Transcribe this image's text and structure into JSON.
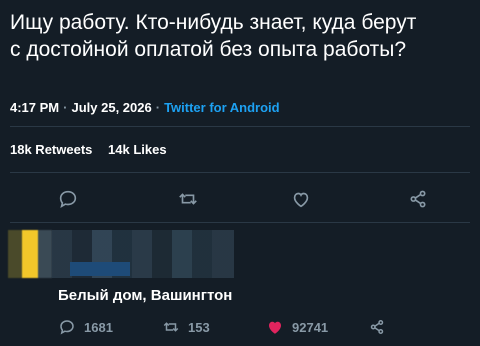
{
  "tweet": {
    "text_line1": "Ищу работу. Кто-нибудь знает, куда берут",
    "text_line2": "с достойной оплатой без опыта работы?",
    "time": "4:17 PM",
    "date": "July 25, 2026",
    "source": "Twitter for Android",
    "separator": "·"
  },
  "stats": {
    "retweets": "18k Retweets",
    "likes": "14k Likes"
  },
  "actions": [
    {
      "icon": "reply-icon"
    },
    {
      "icon": "retweet-icon"
    },
    {
      "icon": "like-icon"
    },
    {
      "icon": "share-icon"
    }
  ],
  "reply": {
    "location": "Белый дом, Вашингтон",
    "reply_count": "1681",
    "retweet_count": "153",
    "like_count": "92741",
    "like_color": "#e0245e"
  },
  "colors": {
    "background": "#141d26",
    "accent": "#1da1f2",
    "muted": "#8899a6"
  }
}
